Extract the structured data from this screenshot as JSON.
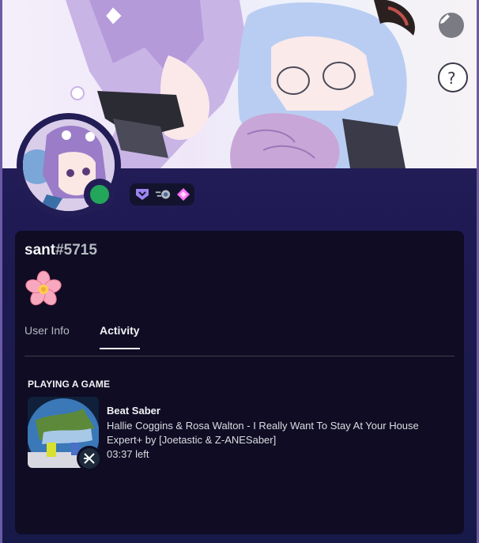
{
  "profile": {
    "username": "sant",
    "discriminator": "#5715",
    "custom_status_emoji": "cherry-blossom-icon",
    "status": "online",
    "status_color": "#23a55a"
  },
  "badges": [
    "hypesquad-icon",
    "nitro-boost-icon",
    "boost-gem-icon"
  ],
  "tabs": [
    {
      "label": "User Info",
      "active": false
    },
    {
      "label": "Activity",
      "active": true
    }
  ],
  "activity": {
    "section_title": "PLAYING A GAME",
    "game_name": "Beat Saber",
    "details": "Hallie Coggins & Rosa Walton - I Really Want To Stay At Your House",
    "state": "Expert+ by [Joetastic & Z-ANESaber]",
    "time_left": "03:37 left"
  },
  "colors": {
    "accent_dark": "#1e1a52",
    "card_bg": "#0f0c24"
  }
}
